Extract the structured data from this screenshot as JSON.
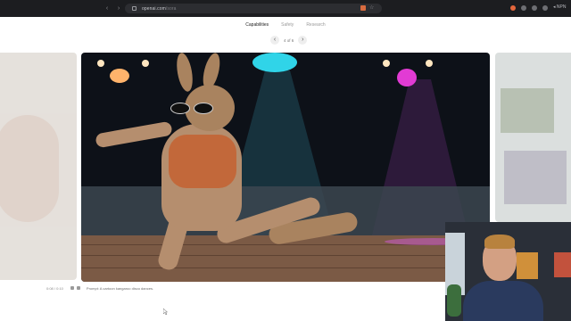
{
  "browser": {
    "url_host": "openai.com",
    "url_path": "/sora",
    "profile": "◂ NPN"
  },
  "topnav": {
    "items": [
      "Capabilities",
      "Safety",
      "Research"
    ],
    "active": "Capabilities"
  },
  "pager": {
    "prev": "‹",
    "count": "4 of 6",
    "next": "›"
  },
  "caption": {
    "time": "0:08 / 0:10",
    "prompt": "Prompt: A cartoon kangaroo disco dances."
  },
  "colors": {
    "chrome_bg": "#1c1d20",
    "page_bg": "#ffffff",
    "active_nav": "#1b1b1b"
  }
}
